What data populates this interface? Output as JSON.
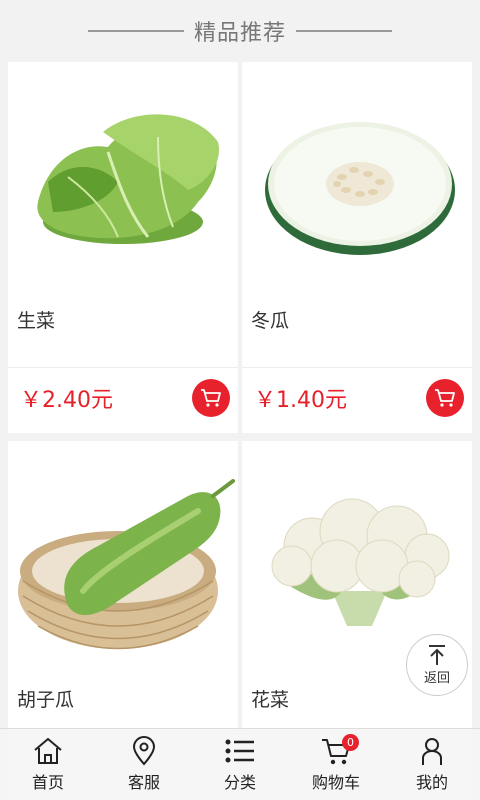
{
  "header": {
    "title": "精品推荐"
  },
  "products": [
    {
      "name": "生菜",
      "price": "￥2.40元",
      "image": "lettuce-image"
    },
    {
      "name": "冬瓜",
      "price": "￥1.40元",
      "image": "winter-melon-image"
    },
    {
      "name": "胡子瓜",
      "price": "",
      "image": "gourd-image"
    },
    {
      "name": "花菜",
      "price": "",
      "image": "cauliflower-image"
    }
  ],
  "back_to_top": {
    "label": "返回"
  },
  "tabbar": {
    "items": [
      {
        "label": "首页",
        "icon": "home-icon"
      },
      {
        "label": "客服",
        "icon": "location-pin-icon"
      },
      {
        "label": "分类",
        "icon": "list-icon"
      },
      {
        "label": "购物车",
        "icon": "cart-icon"
      },
      {
        "label": "我的",
        "icon": "user-icon"
      }
    ],
    "cart_badge": "0"
  },
  "colors": {
    "accent": "#e8222d",
    "price": "#e6212a"
  }
}
